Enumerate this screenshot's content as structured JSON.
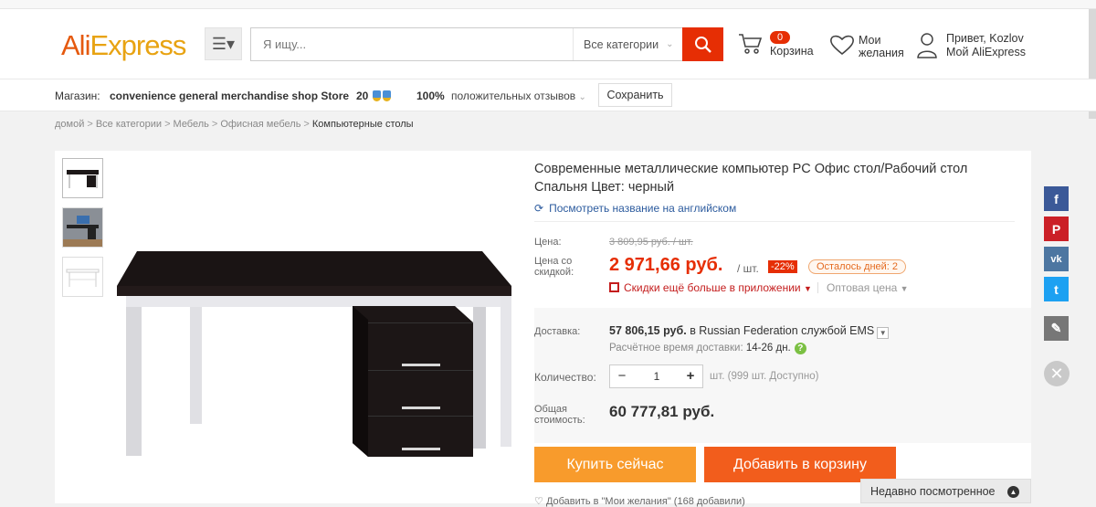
{
  "header": {
    "logo_part1": "Ali",
    "logo_part2": "Express",
    "search_placeholder": "Я ищу...",
    "category_select": "Все категории",
    "cart_count": "0",
    "cart_label": "Корзина",
    "wishlist_line1": "Мои",
    "wishlist_line2": "желания",
    "user_greeting": "Привет, Kozlov",
    "user_account": "Мой AliExpress"
  },
  "store": {
    "label": "Магазин:",
    "name": "convenience general merchandise shop Store",
    "rating": "20",
    "feedback_percent": "100%",
    "feedback_label": "положительных отзывов",
    "save_label": "Сохранить"
  },
  "breadcrumbs": [
    "домой",
    "Все категории",
    "Мебель",
    "Офисная мебель",
    "Компьютерные столы"
  ],
  "product": {
    "title": "Современные металлические компьютер PC Офис стол/Рабочий стол Спальня Цвет: черный",
    "english_link": "Посмотреть название на английском",
    "price_label": "Цена:",
    "old_price": "3 809,95 руб. / шт.",
    "discount_label_1": "Цена со",
    "discount_label_2": "скидкой:",
    "price": "2 971,66 руб.",
    "price_unit": "/ шт.",
    "discount": "-22%",
    "days_left": "Осталось дней: 2",
    "app_promo": "Скидки ещё больше в приложении",
    "wholesale": "Оптовая цена",
    "shipping_label": "Доставка:",
    "shipping_price": "57 806,15 руб.",
    "shipping_text": "в Russian Federation службой EMS",
    "delivery_time_label": "Расчётное время доставки:",
    "delivery_time": "14-26 дн.",
    "quantity_label": "Количество:",
    "quantity": "1",
    "availability": "шт. (999 шт. Доступно)",
    "total_label_1": "Общая",
    "total_label_2": "стоимость:",
    "total": "60 777,81 руб.",
    "buy_now": "Купить сейчас",
    "add_to_cart": "Добавить в корзину",
    "wishlist_add": "Добавить в \"Мои желания\" (168 добавили)"
  },
  "recent": "Недавно посмотренное",
  "colors": {
    "accent": "#e62e04",
    "buy": "#f89b2c",
    "cart": "#f25d1c"
  }
}
